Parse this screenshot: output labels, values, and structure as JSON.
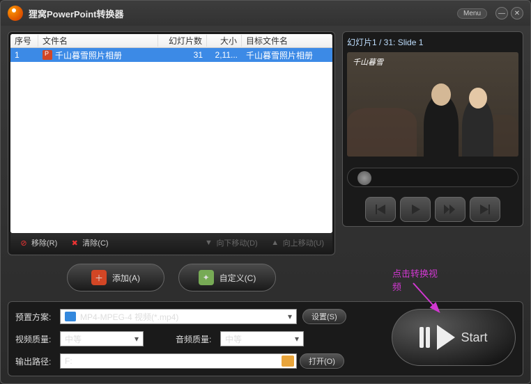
{
  "app": {
    "title": "狸窝PowerPoint转换器",
    "menu": "Menu"
  },
  "table": {
    "headers": {
      "no": "序号",
      "name": "文件名",
      "slides": "幻灯片数",
      "size": "大小",
      "target": "目标文件名"
    },
    "row": {
      "no": "1",
      "name": "千山暮雪照片相册",
      "slides": "31",
      "size": "2,11...",
      "target": "千山暮雪照片相册"
    }
  },
  "actions": {
    "remove": "移除(R)",
    "clear": "清除(C)",
    "down": "向下移动(D)",
    "up": "向上移动(U)"
  },
  "midbuttons": {
    "add": "添加(A)",
    "custom": "自定义(C)"
  },
  "preview": {
    "label": "幻灯片1 / 31: Slide 1",
    "watermark": "千山暮雪"
  },
  "annotation": "点击转换视频",
  "form": {
    "preset_label": "预置方案:",
    "preset_value": "MP4-MPEG-4 视频(*.mp4)",
    "settings": "设置(S)",
    "vq_label": "视频质量:",
    "vq_value": "中等",
    "aq_label": "音频质量:",
    "aq_value": "中等",
    "out_label": "输出路径:",
    "out_value": "F:",
    "open": "打开(O)"
  },
  "start": "Start"
}
